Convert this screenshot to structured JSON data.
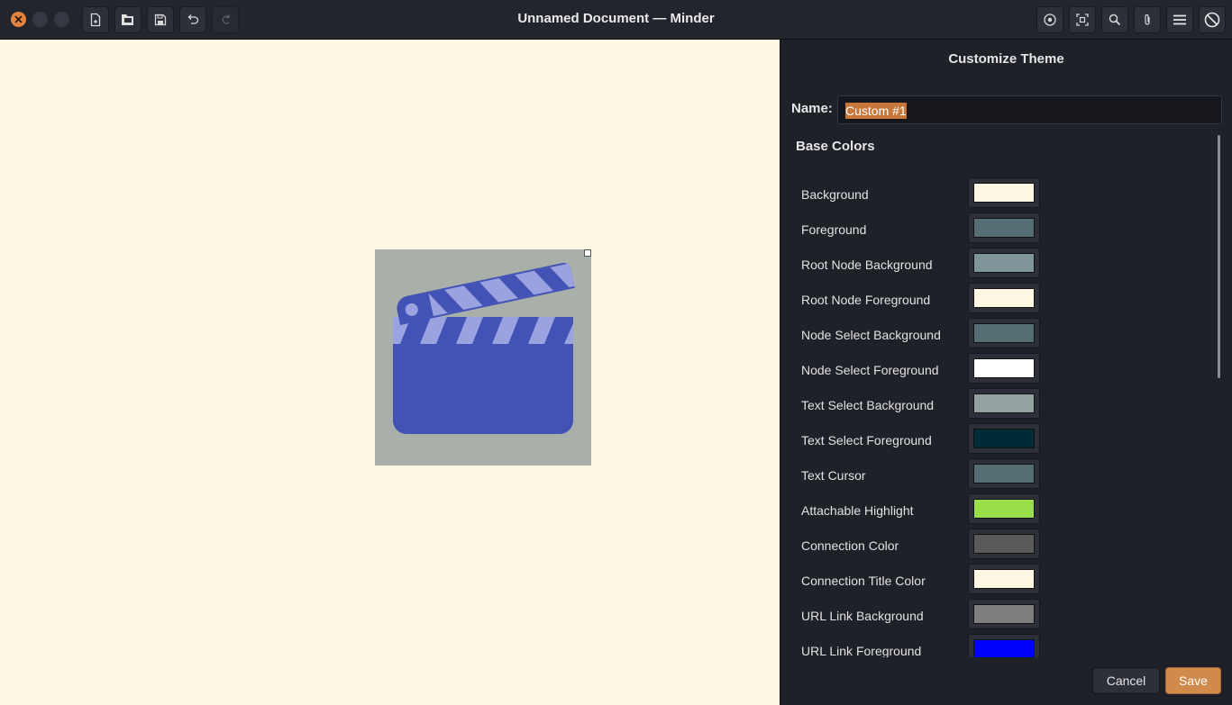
{
  "window": {
    "title": "Unnamed Document — Minder",
    "controls": [
      "close-icon",
      "minimize-icon",
      "maximize-icon"
    ]
  },
  "toolbar_left": [
    {
      "name": "new-document-button",
      "icon": "new-file-icon"
    },
    {
      "name": "open-document-button",
      "icon": "open-folder-icon"
    },
    {
      "name": "save-document-button",
      "icon": "save-icon"
    },
    {
      "name": "undo-button",
      "icon": "undo-icon"
    },
    {
      "name": "redo-button",
      "icon": "redo-icon"
    }
  ],
  "toolbar_right": [
    {
      "name": "focus-mode-button",
      "icon": "target-icon"
    },
    {
      "name": "zoom-fit-button",
      "icon": "zoom-fit-icon"
    },
    {
      "name": "search-button",
      "icon": "search-icon"
    },
    {
      "name": "attach-button",
      "icon": "paperclip-icon"
    },
    {
      "name": "menu-button",
      "icon": "hamburger-icon"
    },
    {
      "name": "properties-button",
      "icon": "circle-slash-icon"
    }
  ],
  "canvas": {
    "background": "#fef7e4",
    "node": {
      "image": "clapperboard-icon",
      "background": "#a9b0a9"
    }
  },
  "panel": {
    "title": "Customize Theme",
    "name_label": "Name:",
    "name_value": "Custom #1",
    "section_title": "Base Colors",
    "colors": [
      {
        "label": "Background",
        "color": "#fef7e4"
      },
      {
        "label": "Foreground",
        "color": "#546e74"
      },
      {
        "label": "Root Node Background",
        "color": "#7e969a"
      },
      {
        "label": "Root Node Foreground",
        "color": "#fef7e4"
      },
      {
        "label": "Node Select Background",
        "color": "#546e74"
      },
      {
        "label": "Node Select Foreground",
        "color": "#ffffff"
      },
      {
        "label": "Text Select Background",
        "color": "#93a1a1"
      },
      {
        "label": "Text Select Foreground",
        "color": "#002b36"
      },
      {
        "label": "Text Cursor",
        "color": "#546e74"
      },
      {
        "label": "Attachable Highlight",
        "color": "#9ade4b"
      },
      {
        "label": "Connection Color",
        "color": "#5a5a5a"
      },
      {
        "label": "Connection Title Color",
        "color": "#fef7e4"
      },
      {
        "label": "URL Link Background",
        "color": "#7e7e7e"
      },
      {
        "label": "URL Link Foreground",
        "color": "#0000ff"
      }
    ],
    "cancel_label": "Cancel",
    "save_label": "Save"
  }
}
